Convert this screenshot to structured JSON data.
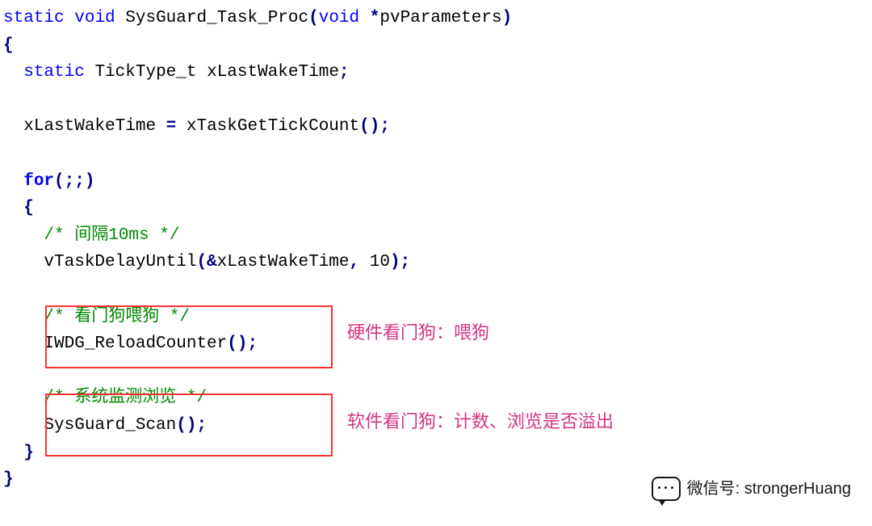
{
  "code": {
    "kw_static": "static",
    "kw_void1": "void",
    "fn_name": "SysGuard_Task_Proc",
    "kw_void2": "void",
    "param": "pvParameters",
    "kw_static2": "static",
    "type_tick": "TickType_t",
    "var_wake": "xLastWakeTime",
    "fn_gettick": "xTaskGetTickCount",
    "kw_for": "for",
    "cmt_interval": "/* 间隔10ms */",
    "fn_delay": "vTaskDelayUntil",
    "num_10": "10",
    "cmt_feed": "/* 看门狗喂狗 */",
    "fn_iwdg": "IWDG_ReloadCounter",
    "cmt_scan": "/* 系统监测浏览 */",
    "fn_scan": "SysGuard_Scan"
  },
  "notes": {
    "hw": "硬件看门狗：喂狗",
    "sw": "软件看门狗：计数、浏览是否溢出"
  },
  "watermark": {
    "label": "微信号",
    "sep": ": ",
    "id": "strongerHuang"
  }
}
